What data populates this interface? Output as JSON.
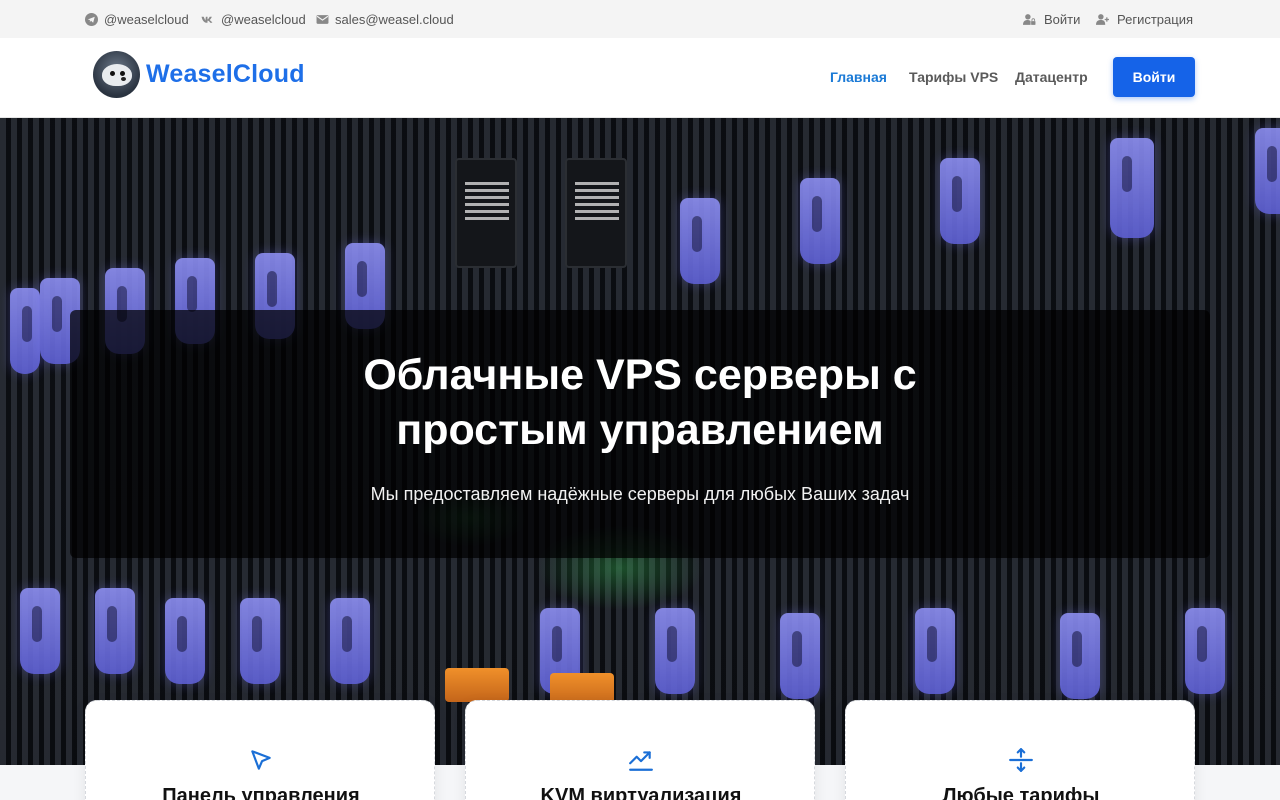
{
  "topbar": {
    "telegram": "@weaselcloud",
    "vk": "@weaselcloud",
    "email": "sales@weasel.cloud",
    "login": "Войти",
    "register": "Регистрация"
  },
  "header": {
    "brand": "WeaselCloud",
    "nav": [
      "Главная",
      "Тарифы VPS",
      "Датацентр"
    ],
    "login_button": "Войти"
  },
  "hero": {
    "title_line1": "Облачные VPS серверы с",
    "title_line2": "простым управлением",
    "subtitle": "Мы предоставляем надёжные серверы для любых Ваших задач"
  },
  "features": [
    {
      "icon": "cursor-icon",
      "title": "Панель управления"
    },
    {
      "icon": "trending-up-icon",
      "title": "KVM виртуализация"
    },
    {
      "icon": "arrows-vertical-icon",
      "title": "Любые тарифы"
    }
  ],
  "colors": {
    "accent": "#1563e8",
    "nav_active": "#1b7ad6",
    "brand": "#1e6fe8"
  }
}
